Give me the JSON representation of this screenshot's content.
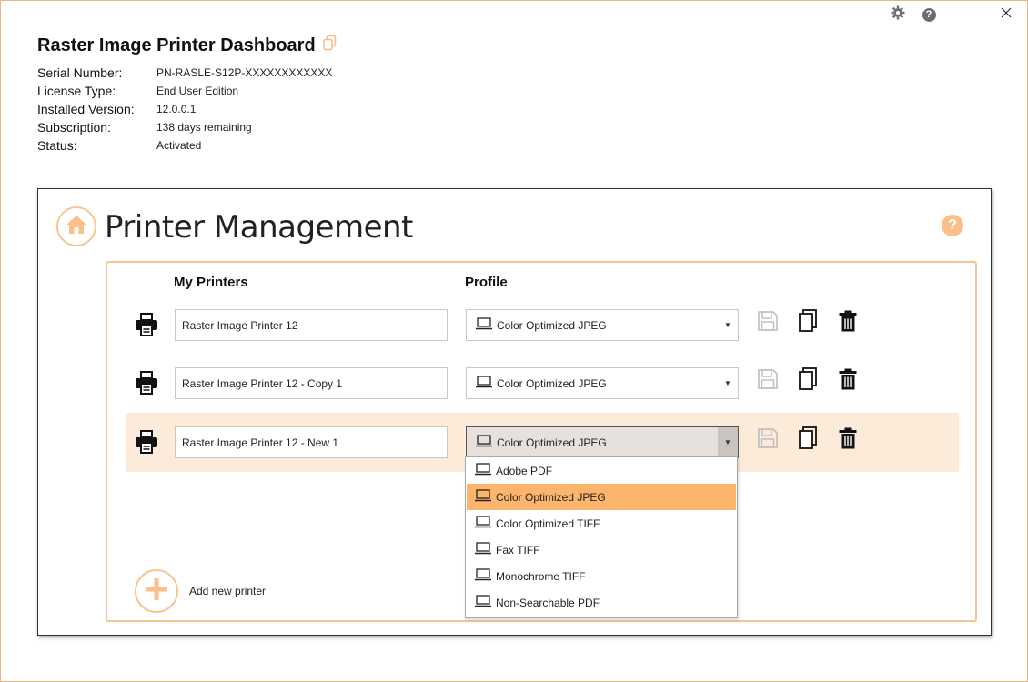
{
  "app": {
    "title": "Raster Image Printer Dashboard"
  },
  "info": [
    {
      "label": "Serial Number:",
      "value": "PN-RASLE-S12P-XXXXXXXXXXXX"
    },
    {
      "label": "License Type:",
      "value": "End User Edition"
    },
    {
      "label": "Installed Version:",
      "value": "12.0.0.1"
    },
    {
      "label": "Subscription:",
      "value": "138 days remaining"
    },
    {
      "label": "Status:",
      "value": "Activated"
    }
  ],
  "management": {
    "title": "Printer Management",
    "help_glyph": "?",
    "col_printers": "My Printers",
    "col_profile": "Profile",
    "add_label": "Add new printer"
  },
  "printers": [
    {
      "name": "Raster Image Printer 12",
      "profile": "Color Optimized JPEG"
    },
    {
      "name": "Raster Image Printer 12 - Copy 1",
      "profile": "Color Optimized JPEG"
    },
    {
      "name": "Raster Image Printer 12 - New 1",
      "profile": "Color Optimized JPEG"
    }
  ],
  "profile_options": [
    "Adobe PDF",
    "Color Optimized JPEG",
    "Color Optimized TIFF",
    "Fax TIFF",
    "Monochrome TIFF",
    "Non-Searchable PDF"
  ],
  "selected_option": "Color Optimized JPEG",
  "colors": {
    "accent": "#f6c594",
    "selected_row": "#fdebd9",
    "highlight": "#fdb56e"
  },
  "icons": {
    "settings": "gear-icon",
    "help": "help-icon",
    "minimize": "minimize-icon",
    "close": "close-icon",
    "copy_title": "copy-icon",
    "home": "home-icon",
    "printer": "printer-icon",
    "save": "save-icon",
    "duplicate": "copy-icon",
    "delete": "trash-icon",
    "monitor": "monitor-icon",
    "add": "plus-icon"
  }
}
